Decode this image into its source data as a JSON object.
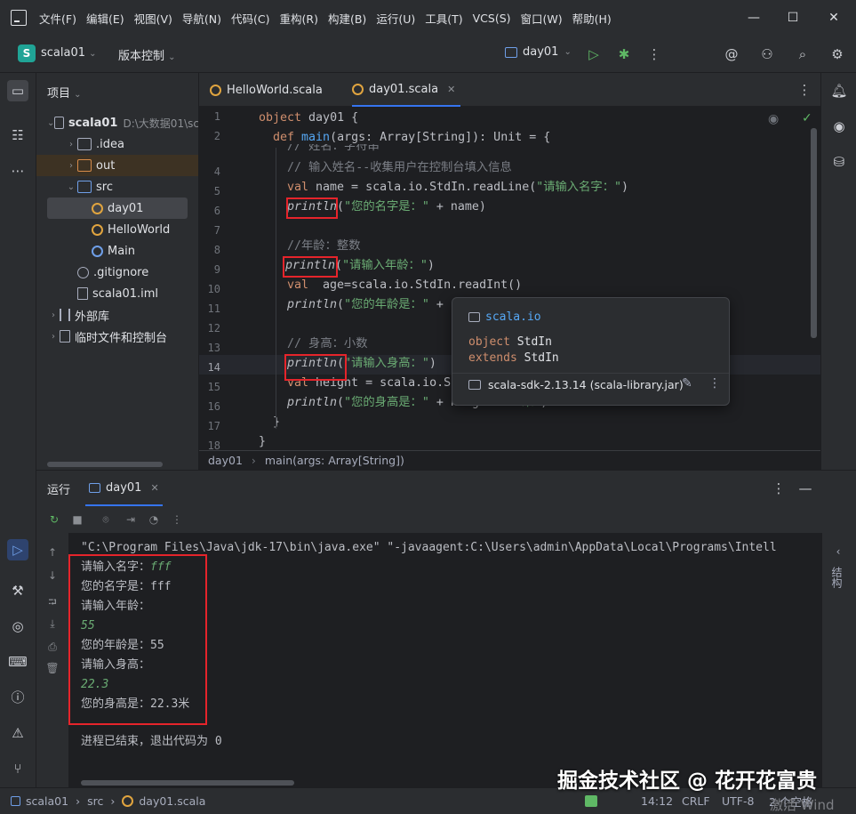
{
  "menu": [
    "文件(F)",
    "编辑(E)",
    "视图(V)",
    "导航(N)",
    "代码(C)",
    "重构(R)",
    "构建(B)",
    "运行(U)",
    "工具(T)",
    "VCS(S)",
    "窗口(W)",
    "帮助(H)"
  ],
  "toolbar": {
    "project_badge": "S",
    "project_name": "scala01",
    "vcs": "版本控制",
    "run_config": "day01"
  },
  "project": {
    "title": "项目",
    "root_name": "scala01",
    "root_path": "D:\\大数据01\\sc",
    "items": [
      ".idea",
      "out",
      "src",
      "day01",
      "HelloWorld",
      "Main",
      ".gitignore",
      "scala01.iml",
      "外部库",
      "临时文件和控制台"
    ]
  },
  "tabs": [
    "HelloWorld.scala",
    "day01.scala"
  ],
  "line_numbers": [
    "1",
    "2",
    "",
    "4",
    "5",
    "6",
    "7",
    "8",
    "9",
    "10",
    "11",
    "12",
    "13",
    "14",
    "15",
    "16",
    "17",
    "18"
  ],
  "code": {
    "l1a": "object ",
    "l1b": "day01 {",
    "l2a": "def ",
    "l2b": "main",
    "l2c": "(args: Array[String]): Unit = {",
    "l3": "// 姓名：字符串",
    "l4": "// 输入姓名--收集用户在控制台填入信息",
    "l5a": "val ",
    "l5b": "name = scala.io.StdIn.readLine(",
    "l5c": "\"请输入名字：\"",
    "l5d": ")",
    "l6a": "println",
    "l6b": "(",
    "l6c": "\"您的名字是：\"",
    "l6d": " + name)",
    "l8": "//年龄：整数",
    "l9a": "println",
    "l9b": "(",
    "l9c": "\"请输入年龄：\"",
    "l9d": ")",
    "l10a": "val ",
    "l10b": " age=scala.io.StdIn.readInt()",
    "l11a": "println",
    "l11b": "(",
    "l11c": "\"您的年龄是：\"",
    "l11d": " + ",
    "l13": "// 身高：小数",
    "l14a": "println",
    "l14b": "(",
    "l14c": "\"请输入身高：\"",
    "l14d": ")",
    "l15a": "val ",
    "l15b": "height = scala.io.S",
    "l16a": "println",
    "l16b": "(",
    "l16c": "\"您的身高是：\"",
    "l16d": " + height + ",
    "l16e": "\"米\"",
    "l16f": ")",
    "l17": "}",
    "l18": "}"
  },
  "breadcrumb": [
    "day01",
    "main(args: Array[String])"
  ],
  "popup": {
    "package": "scala.io",
    "decl_kw": "object",
    "decl_name": "StdIn",
    "ext_kw": "extends",
    "ext_name": "StdIn",
    "library": "scala-sdk-2.13.14 (scala-library.jar)"
  },
  "run": {
    "title": "运行",
    "tab": "day01",
    "cmd": "\"C:\\Program Files\\Java\\jdk-17\\bin\\java.exe\" \"-javaagent:C:\\Users\\admin\\AppData\\Local\\Programs\\Intell",
    "lines": [
      {
        "prompt": "请输入名字：",
        "input": "fff"
      },
      {
        "text": "您的名字是：fff"
      },
      {
        "text": "请输入年龄："
      },
      {
        "input": "55"
      },
      {
        "text": "您的年龄是：55"
      },
      {
        "text": "请输入身高："
      },
      {
        "input": "22.3"
      },
      {
        "text": "您的身高是：22.3米"
      }
    ],
    "exit": "进程已结束，退出代码为 0",
    "side_label": "结构"
  },
  "status": {
    "crumbs": [
      "scala01",
      "src",
      "day01.scala"
    ],
    "position": "14:12",
    "line_sep": "CRLF",
    "encoding": "UTF-8",
    "indent": "2 个空格"
  },
  "watermark": "掘金技术社区 @ 花开花富贵",
  "activate": "激活 Wind"
}
